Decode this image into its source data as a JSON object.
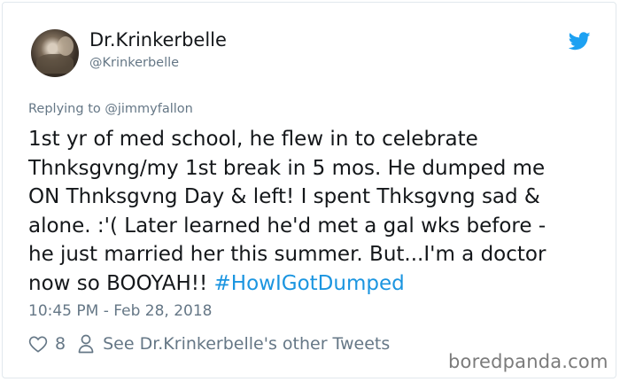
{
  "tweet": {
    "display_name": "Dr.Krinkerbelle",
    "handle": "@Krinkerbelle",
    "replying_prefix": "Replying to",
    "replying_to": "@jimmyfallon",
    "text": "1st yr of med school, he flew in to celebrate\nThnksgvng/my 1st break in 5 mos. He dumped me\nON Thnksgvng Day & left! I spent Thksgvng sad &\nalone. :'( Later learned he'd met a gal wks before -\nhe just married her this summer. But...I'm a doctor\nnow so BOOYAH!!",
    "hashtag": "#HowIGotDumped",
    "timestamp": "10:45 PM - Feb 28, 2018",
    "like_count": "8",
    "other_tweets_link": "See Dr.Krinkerbelle's other Tweets"
  },
  "watermark": "boredpanda.com",
  "icons": {
    "bird": "twitter-bird-icon",
    "heart": "heart-icon",
    "person": "person-icon"
  },
  "colors": {
    "twitter_blue": "#1da1f2",
    "hashtag_blue": "#1b95e0",
    "secondary_text": "#657786",
    "primary_text": "#14171a"
  }
}
